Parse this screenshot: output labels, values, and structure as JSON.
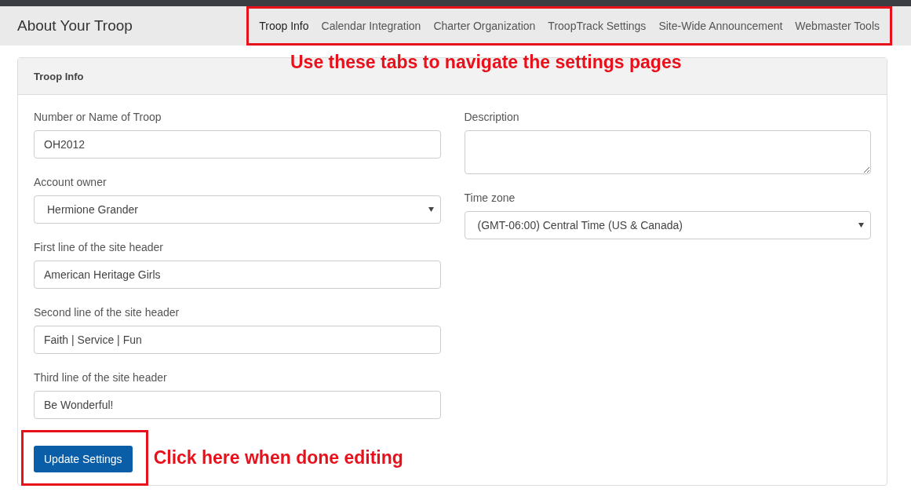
{
  "header": {
    "title": "About Your Troop"
  },
  "tabs": [
    {
      "label": "Troop Info",
      "selected": true
    },
    {
      "label": "Calendar Integration",
      "selected": false
    },
    {
      "label": "Charter Organization",
      "selected": false
    },
    {
      "label": "TroopTrack Settings",
      "selected": false
    },
    {
      "label": "Site-Wide Announcement",
      "selected": false
    },
    {
      "label": "Webmaster Tools",
      "selected": false
    }
  ],
  "card": {
    "title": "Troop Info",
    "left_fields": [
      {
        "kind": "text",
        "label": "Number or Name of Troop",
        "value": "OH2012"
      },
      {
        "kind": "select",
        "label": "Account owner",
        "value": "Hermione Grander"
      },
      {
        "kind": "text",
        "label": "First line of the site header",
        "value": "American Heritage Girls"
      },
      {
        "kind": "text",
        "label": "Second line of the site header",
        "value": "Faith | Service | Fun"
      },
      {
        "kind": "text",
        "label": "Third line of the site header",
        "value": "Be Wonderful!"
      }
    ],
    "right_fields": [
      {
        "kind": "textarea",
        "label": "Description"
      },
      {
        "kind": "select",
        "label": "Time zone",
        "value": "(GMT-06:00) Central Time (US & Canada)"
      }
    ],
    "button": "Update Settings"
  },
  "annotations": {
    "tabs_note": "Use these tabs to navigate the settings pages",
    "button_note": "Click here when done editing"
  }
}
